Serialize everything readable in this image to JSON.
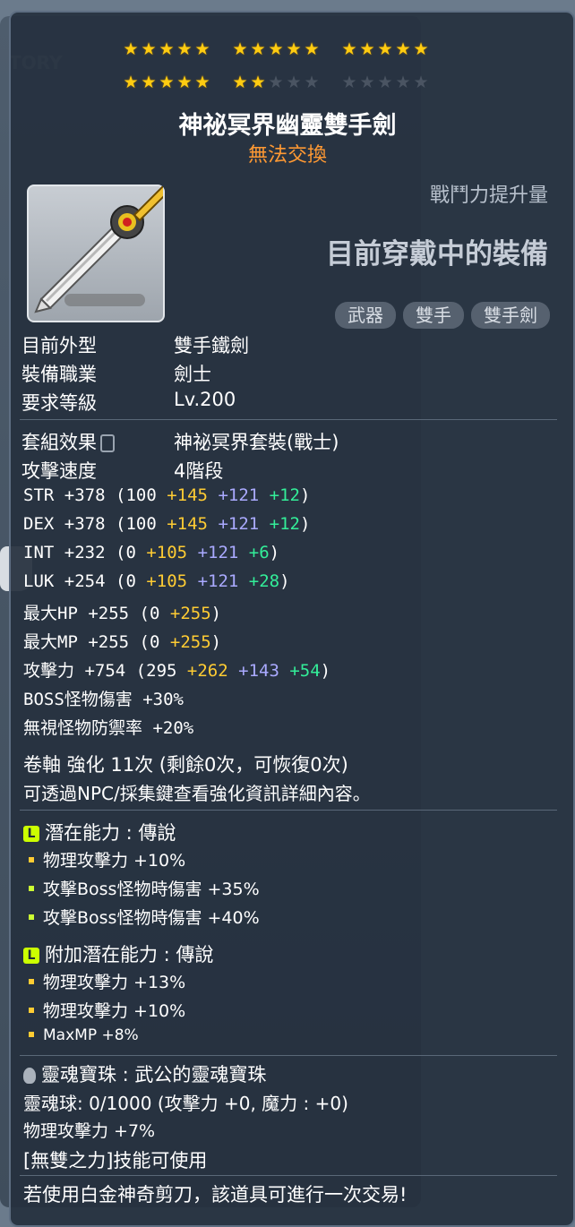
{
  "stars": {
    "total": 25,
    "filled": 22
  },
  "item": {
    "name": "神祕冥界幽靈雙手劍",
    "trade": "無法交換"
  },
  "power_label": "戰鬥力提升量",
  "equipped_label": "目前穿戴中的裝備",
  "tags": [
    "武器",
    "雙手",
    "雙手劍"
  ],
  "info": [
    {
      "label": "目前外型",
      "value": "雙手鐵劍"
    },
    {
      "label": "裝備職業",
      "value": "劍士"
    },
    {
      "label": "要求等級",
      "value": "Lv.200"
    }
  ],
  "set_label": "套組效果",
  "set_value": "神祕冥界套裝(戰士)",
  "speed_label": "攻擊速度",
  "speed_value": "4階段",
  "stats": [
    {
      "name": "STR",
      "total": "+378",
      "base": "100",
      "yellow": "+145",
      "blue": "+121",
      "green": "+12"
    },
    {
      "name": "DEX",
      "total": "+378",
      "base": "100",
      "yellow": "+145",
      "blue": "+121",
      "green": "+12"
    },
    {
      "name": "INT",
      "total": "+232",
      "base": "0",
      "yellow": "+105",
      "blue": "+121",
      "green": "+6"
    },
    {
      "name": "LUK",
      "total": "+254",
      "base": "0",
      "yellow": "+105",
      "blue": "+121",
      "green": "+28"
    },
    {
      "name": "最大HP",
      "total": "+255",
      "base": "0",
      "yellow": "+255"
    },
    {
      "name": "最大MP",
      "total": "+255",
      "base": "0",
      "yellow": "+255"
    },
    {
      "name": "攻擊力",
      "total": "+754",
      "base": "295",
      "yellow": "+262",
      "blue": "+143",
      "green": "+54"
    }
  ],
  "boss": {
    "label": "BOSS怪物傷害",
    "value": "+30%"
  },
  "ignore": {
    "label": "無視怪物防禦率",
    "value": "+20%"
  },
  "scroll": "卷軸 強化 11次 (剩餘0次，可恢復0次)",
  "scroll_hint": "可透過NPC/採集鍵查看強化資訊詳細內容。",
  "potential": {
    "badge": "L",
    "title": "潛在能力 : 傳說",
    "lines": [
      "物理攻擊力 +10%",
      "攻擊Boss怪物時傷害 +35%",
      "攻擊Boss怪物時傷害 +40%"
    ]
  },
  "additional": {
    "badge": "L",
    "title": "附加潛在能力 : 傳說",
    "lines": [
      "物理攻擊力 +13%",
      "物理攻擊力 +10%",
      "MaxMP +8%"
    ]
  },
  "soul": {
    "title": "靈魂寶珠 : 武公的靈魂寶珠",
    "orb": "靈魂球: 0/1000 (攻擊力 +0, 魔力 : +0)",
    "effect": "物理攻擊力 +7%",
    "skill": "[無雙之力]技能可使用"
  },
  "footer": "若使用白金神奇剪刀，該道具可進行一次交易!",
  "colors": {
    "star": "#ffcc11",
    "trade": "#ff9933",
    "legend": "#ccff00"
  }
}
